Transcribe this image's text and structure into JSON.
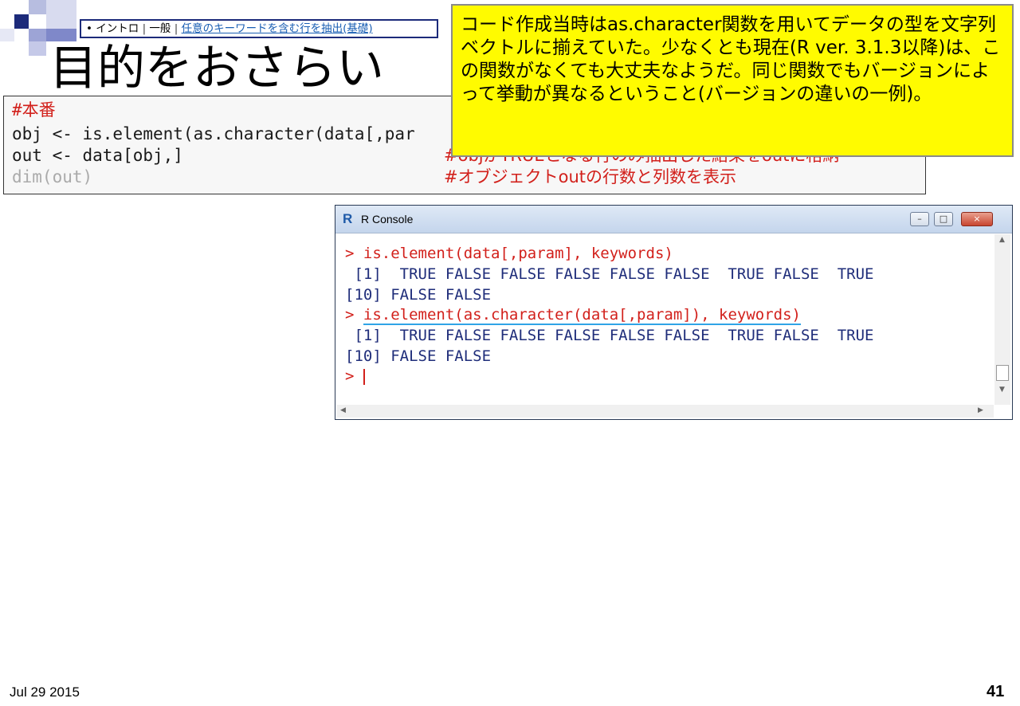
{
  "breadcrumb": {
    "bullet": "•",
    "items": [
      "イントロ",
      "一般",
      "任意のキーワードを含む行を抽出(基礎)"
    ],
    "separator": "|"
  },
  "slide_title": "目的をおさらい",
  "code": {
    "line1": "#本番",
    "line2": "obj <- is.element(as.character(data[,par",
    "line3": "out <- data[obj,]",
    "line3_comment": "#objがTRUEとなる行のみ抽出した結果をoutに格納",
    "line4": "dim(out)",
    "line4_comment": "#オブジェクトoutの行数と列数を表示"
  },
  "note": {
    "text": "コード作成当時はas.character関数を用いてデータの型を文字列ベクトルに揃えていた。少なくとも現在(R ver. 3.1.3以降)は、この関数がなくても大丈夫なようだ。同じ関数でもバージョンによって挙動が異なるということ(バージョンの違いの一例)。"
  },
  "console": {
    "title": "R Console",
    "logo": "R",
    "buttons": {
      "minimize": "–",
      "maximize": "□",
      "close": "×"
    },
    "lines": [
      {
        "prompt": "> ",
        "text": "is.element(data[,param], keywords)"
      },
      {
        "text": " [1]  TRUE FALSE FALSE FALSE FALSE FALSE  TRUE FALSE  TRUE"
      },
      {
        "text": "[10] FALSE FALSE"
      },
      {
        "prompt": "> ",
        "text": "is.element(as.character(data[,param]), keywords)"
      },
      {
        "text": " [1]  TRUE FALSE FALSE FALSE FALSE FALSE  TRUE FALSE  TRUE"
      },
      {
        "text": "[10] FALSE FALSE"
      },
      {
        "prompt": "> ",
        "text": ""
      }
    ]
  },
  "footer": {
    "date": "Jul 29 2015",
    "page": "41"
  },
  "colors": {
    "note_bg": "#fffb00",
    "comment_red": "#d2201b",
    "output_navy": "#1f2d7a",
    "highlight_cyan": "#2fa4e7"
  }
}
